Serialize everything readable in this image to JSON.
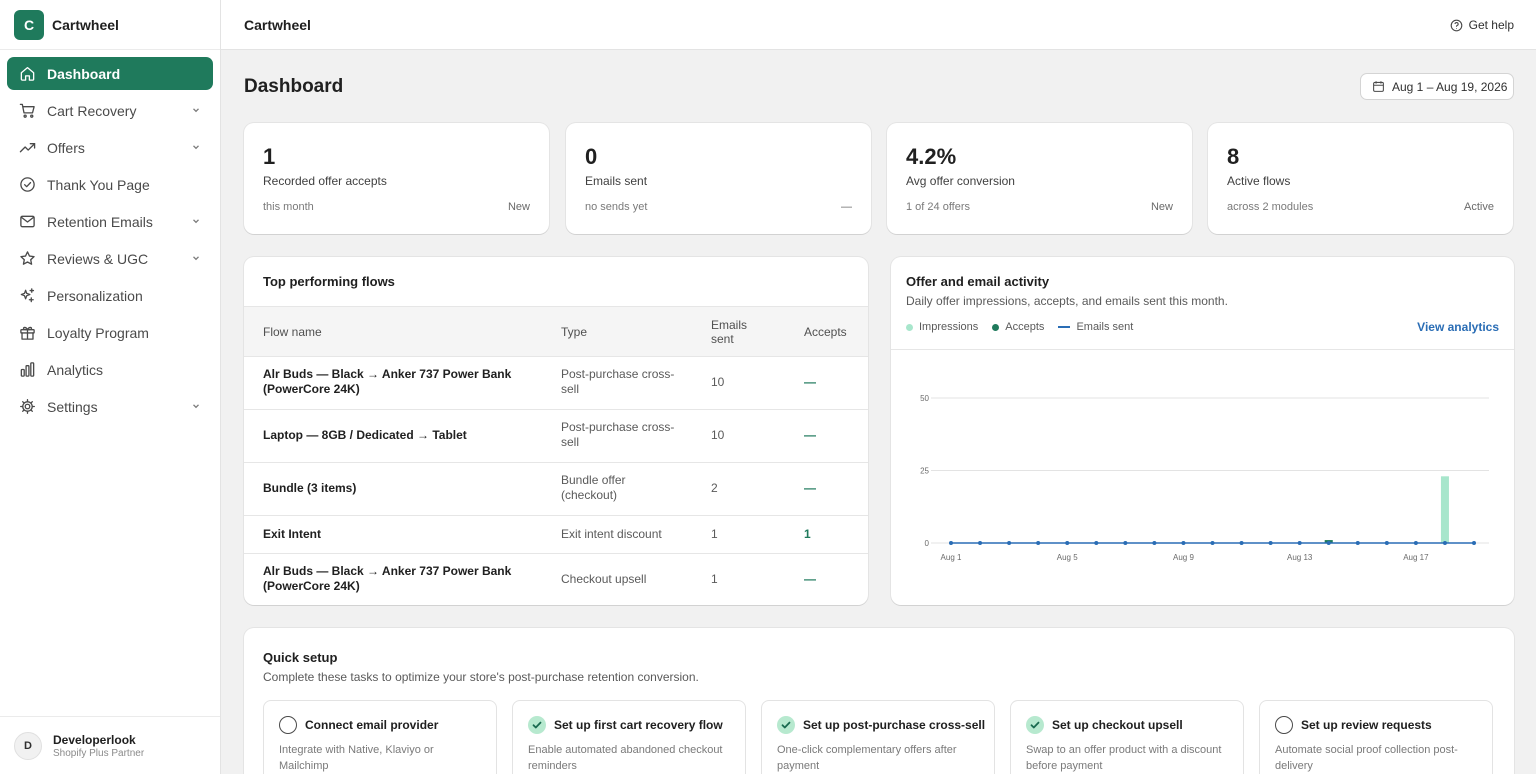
{
  "app": {
    "logo_letter": "C",
    "name": "Cartwheel"
  },
  "sidebar": {
    "items": [
      {
        "label": "Dashboard",
        "icon": "home-icon",
        "active": true,
        "expandable": false
      },
      {
        "label": "Cart Recovery",
        "icon": "cart-icon",
        "active": false,
        "expandable": true
      },
      {
        "label": "Offers",
        "icon": "trending-up-icon",
        "active": false,
        "expandable": true
      },
      {
        "label": "Thank You Page",
        "icon": "check-circle-icon",
        "active": false,
        "expandable": false
      },
      {
        "label": "Retention Emails",
        "icon": "mail-icon",
        "active": false,
        "expandable": true
      },
      {
        "label": "Reviews & UGC",
        "icon": "star-icon",
        "active": false,
        "expandable": true
      },
      {
        "label": "Personalization",
        "icon": "sparkle-icon",
        "active": false,
        "expandable": false
      },
      {
        "label": "Loyalty Program",
        "icon": "gift-icon",
        "active": false,
        "expandable": false
      },
      {
        "label": "Analytics",
        "icon": "bar-chart-icon",
        "active": false,
        "expandable": false
      },
      {
        "label": "Settings",
        "icon": "gear-icon",
        "active": false,
        "expandable": true
      }
    ],
    "user": {
      "avatar_letter": "D",
      "name": "Developerlook",
      "role": "Shopify Plus Partner"
    }
  },
  "topbar": {
    "title": "Cartwheel",
    "help_label": "Get help"
  },
  "page": {
    "title": "Dashboard",
    "date_range": "Aug 1 – Aug 19, 2026"
  },
  "stats": [
    {
      "value": "1",
      "label": "Recorded offer accepts",
      "sub": "this month",
      "badge": "New"
    },
    {
      "value": "0",
      "label": "Emails sent",
      "sub": "no sends yet",
      "badge": "—"
    },
    {
      "value": "4.2%",
      "label": "Avg offer conversion",
      "sub": "1 of 24 offers",
      "badge": "New"
    },
    {
      "value": "8",
      "label": "Active flows",
      "sub": "across 2 modules",
      "badge": "Active"
    }
  ],
  "flows": {
    "title": "Top performing flows",
    "columns": [
      "Flow name",
      "Type",
      "Emails sent",
      "Accepts"
    ],
    "rows": [
      {
        "name": "Alr Buds — Black → Anker 737 Power Bank (PowerCore 24K)",
        "type": "Post-purchase cross-sell",
        "emails": "10",
        "accepts": "—"
      },
      {
        "name": "Laptop — 8GB / Dedicated → Tablet",
        "type": "Post-purchase cross-sell",
        "emails": "10",
        "accepts": "—"
      },
      {
        "name": "Bundle (3 items)",
        "type": "Bundle offer (checkout)",
        "emails": "2",
        "accepts": "—"
      },
      {
        "name": "Exit Intent",
        "type": "Exit intent discount",
        "emails": "1",
        "accepts": "1"
      },
      {
        "name": "Alr Buds — Black → Anker 737 Power Bank (PowerCore 24K)",
        "type": "Checkout upsell",
        "emails": "1",
        "accepts": "—"
      }
    ]
  },
  "activity": {
    "title": "Offer and email activity",
    "subtitle": "Daily offer impressions, accepts, and emails sent this month.",
    "legend": [
      "Impressions",
      "Accepts",
      "Emails sent"
    ],
    "view_link": "View analytics",
    "colors": {
      "impressions": "#a8e6cc",
      "accepts": "#1f7a5c",
      "emails": "#2a6db5"
    }
  },
  "chart_data": {
    "type": "bar",
    "x": [
      "Aug 1",
      "Aug 2",
      "Aug 3",
      "Aug 4",
      "Aug 5",
      "Aug 6",
      "Aug 7",
      "Aug 8",
      "Aug 9",
      "Aug 10",
      "Aug 11",
      "Aug 12",
      "Aug 13",
      "Aug 14",
      "Aug 15",
      "Aug 16",
      "Aug 17",
      "Aug 18",
      "Aug 19"
    ],
    "x_tick_labels": [
      "Aug 1",
      "Aug 5",
      "Aug 9",
      "Aug 13",
      "Aug 17"
    ],
    "series": [
      {
        "name": "Impressions",
        "kind": "bar",
        "values": [
          0,
          0,
          0,
          0,
          0,
          0,
          0,
          0,
          0,
          0,
          0,
          0,
          0,
          1,
          0,
          0,
          0,
          23,
          0
        ]
      },
      {
        "name": "Accepts",
        "kind": "bar",
        "values": [
          0,
          0,
          0,
          0,
          0,
          0,
          0,
          0,
          0,
          0,
          0,
          0,
          0,
          1,
          0,
          0,
          0,
          0,
          0
        ]
      },
      {
        "name": "Emails sent",
        "kind": "line",
        "values": [
          0,
          0,
          0,
          0,
          0,
          0,
          0,
          0,
          0,
          0,
          0,
          0,
          0,
          0,
          0,
          0,
          0,
          0,
          0
        ]
      }
    ],
    "y_ticks": [
      0,
      25,
      50
    ],
    "ylim": [
      0,
      50
    ],
    "grid": true,
    "legend_position": "top-left"
  },
  "quick_setup": {
    "title": "Quick setup",
    "subtitle": "Complete these tasks to optimize your store's post-purchase retention conversion.",
    "tasks": [
      {
        "title": "Connect email provider",
        "desc": "Integrate with Native, Klaviyo or Mailchimp",
        "done": false
      },
      {
        "title": "Set up first cart recovery flow",
        "desc": "Enable automated abandoned checkout reminders",
        "done": true
      },
      {
        "title": "Set up post-purchase cross-sell",
        "desc": "One-click complementary offers after payment",
        "done": true
      },
      {
        "title": "Set up checkout upsell",
        "desc": "Swap to an offer product with a discount before payment",
        "done": true
      },
      {
        "title": "Set up review requests",
        "desc": "Automate social proof collection post-delivery",
        "done": false
      }
    ]
  }
}
